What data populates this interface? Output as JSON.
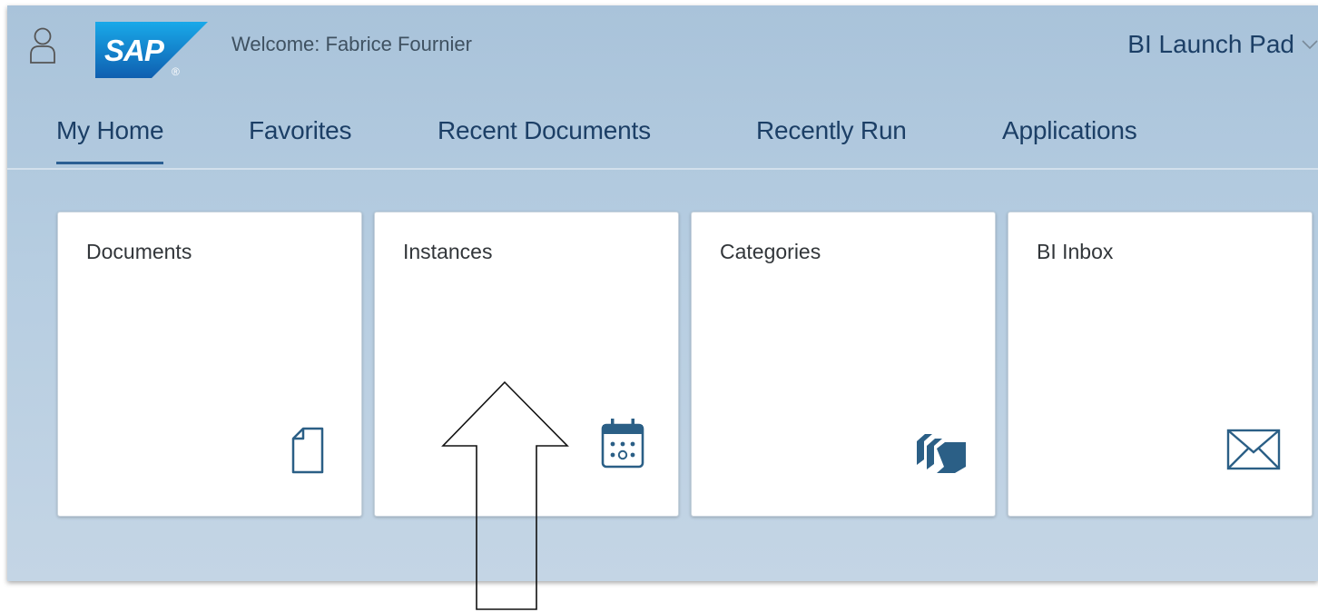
{
  "header": {
    "brand": "SAP",
    "welcome_text": "Welcome: Fabrice Fournier",
    "app_switcher_label": "BI Launch Pad",
    "user_icon": "user-icon",
    "app_switcher_icon": "chevron-down-icon"
  },
  "tabs": [
    {
      "label": "My Home",
      "active": true
    },
    {
      "label": "Favorites",
      "active": false
    },
    {
      "label": "Recent Documents",
      "active": false
    },
    {
      "label": "Recently Run",
      "active": false
    },
    {
      "label": "Applications",
      "active": false
    }
  ],
  "tiles": [
    {
      "title": "Documents",
      "icon": "document-icon"
    },
    {
      "title": "Instances",
      "icon": "calendar-icon"
    },
    {
      "title": "Categories",
      "icon": "categories-icon"
    },
    {
      "title": "BI Inbox",
      "icon": "envelope-icon"
    }
  ],
  "colors": {
    "accent": "#1c3f66",
    "icon": "#2b5f86",
    "active_tab_underline": "#2b5f93",
    "shell_background": "#b6cde1",
    "sap_logo_blue": "#1b7cd1"
  }
}
